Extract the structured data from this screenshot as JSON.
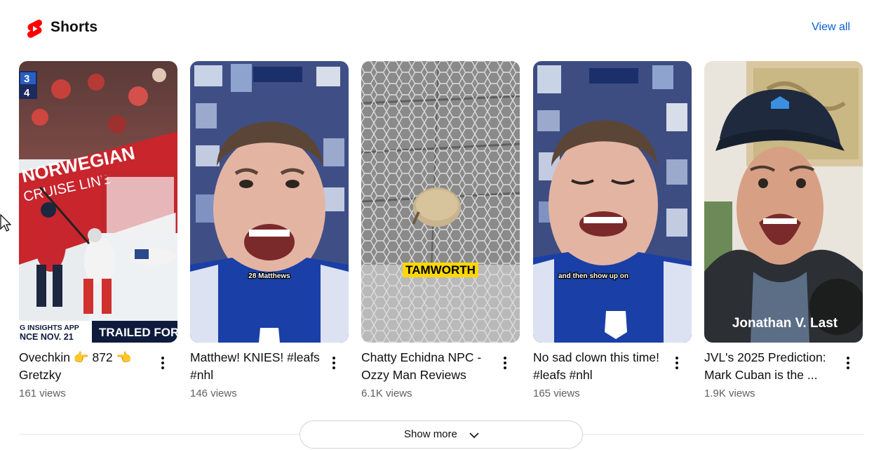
{
  "section": {
    "title": "Shorts",
    "icon": "youtube-shorts-icon",
    "accent_color": "#ff0000",
    "view_all_label": "View all"
  },
  "shorts": [
    {
      "title": "Ovechkin 👉 872 👈 Gretzky",
      "views": "161 views",
      "overlay": {
        "scoreboard": [
          "3",
          "4"
        ],
        "banner": "NORWEGIAN",
        "banner_sub": "CRUISE LINE",
        "ticker_top": "G INSIGHTS APP",
        "ticker_date": "NCE NOV. 21",
        "ticker_right": "TRAILED FOR"
      }
    },
    {
      "title": "Matthew! KNIES! #leafs #nhl",
      "views": "146 views",
      "overlay": {
        "caption": "28 Matthews"
      }
    },
    {
      "title": "Chatty Echidna NPC - Ozzy Man Reviews",
      "views": "6.1K views",
      "overlay": {
        "caption": "TAMWORTH"
      }
    },
    {
      "title": "No sad clown this time! #leafs #nhl",
      "views": "165 views",
      "overlay": {
        "caption": "and then show up on"
      }
    },
    {
      "title": "JVL's 2025 Prediction: Mark Cuban is the ...",
      "views": "1.9K views",
      "overlay": {
        "caption": "Jonathan V. Last"
      }
    }
  ],
  "show_more_label": "Show more"
}
